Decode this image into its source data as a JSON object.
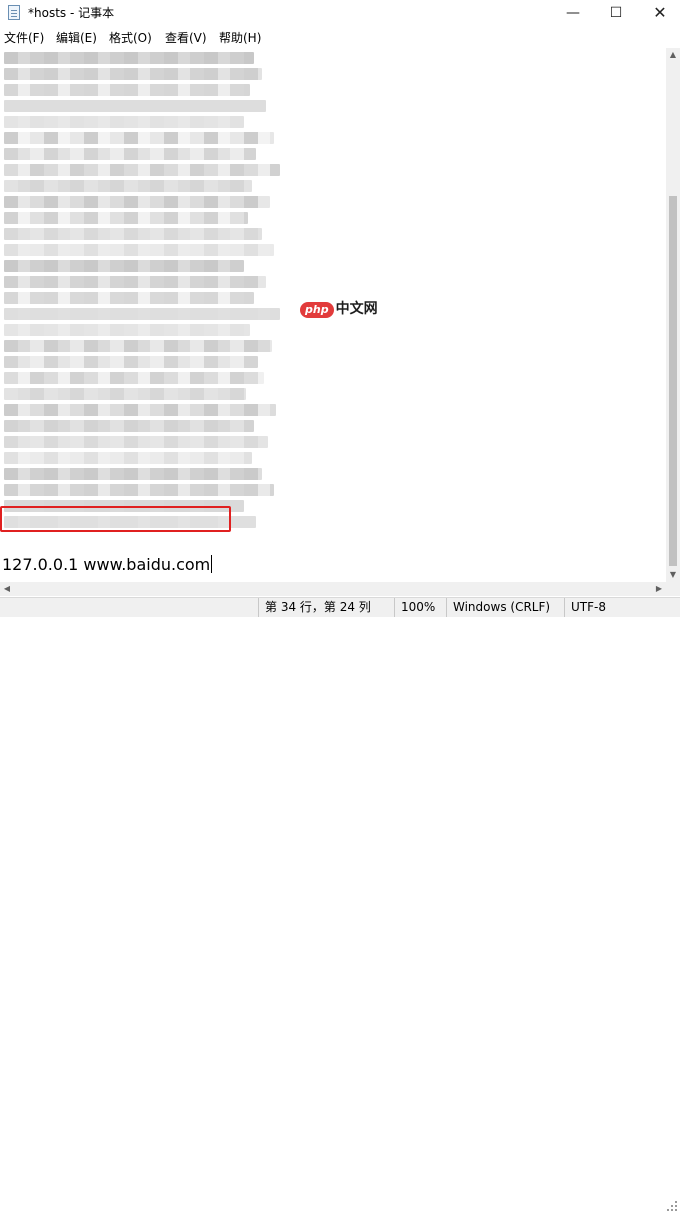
{
  "window": {
    "title": "*hosts - 记事本",
    "minimize_glyph": "—",
    "maximize_glyph": "☐",
    "close_glyph": "✕",
    "app_icon": "notepad-icon"
  },
  "menu": {
    "items": [
      {
        "label": "文件(F)"
      },
      {
        "label": "编辑(E)"
      },
      {
        "label": "格式(O)"
      },
      {
        "label": "查看(V)"
      },
      {
        "label": "帮助(H)"
      }
    ]
  },
  "editor": {
    "visible_line": "127.0.0.1 www.baidu.com",
    "watermark_php": "php",
    "watermark_cn": "中文网",
    "highlight_color": "#e02020"
  },
  "status": {
    "position": "第 34 行，第 24 列",
    "zoom": "100%",
    "line_ending": "Windows (CRLF)",
    "encoding": "UTF-8"
  }
}
